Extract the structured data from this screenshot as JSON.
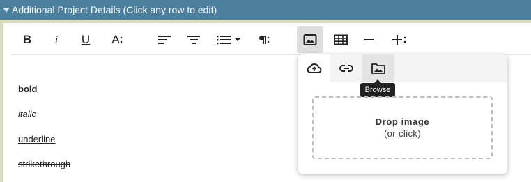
{
  "panel": {
    "title": "Additional Project Details (Click any row to edit)"
  },
  "toolbar": {
    "buttons": [
      {
        "name": "bold",
        "icon": "bold-icon"
      },
      {
        "name": "italic",
        "icon": "italic-icon"
      },
      {
        "name": "underline",
        "icon": "underline-icon"
      },
      {
        "name": "font-size",
        "icon": "font-size-icon"
      },
      {
        "name": "align-left",
        "icon": "align-left-icon"
      },
      {
        "name": "align-center",
        "icon": "align-center-icon"
      },
      {
        "name": "list",
        "icon": "unordered-list-icon"
      },
      {
        "name": "paragraph",
        "icon": "paragraph-icon"
      },
      {
        "name": "insert-image",
        "icon": "image-icon",
        "active": true
      },
      {
        "name": "insert-table",
        "icon": "table-icon"
      },
      {
        "name": "horizontal-rule",
        "icon": "minus-icon"
      },
      {
        "name": "insert-more",
        "icon": "plus-icon"
      },
      {
        "name": "more",
        "icon": "more-vertical-icon"
      }
    ],
    "glyphs": {
      "bold": "B",
      "italic": "i",
      "underline": "U",
      "font_size": "A"
    }
  },
  "content": {
    "lines": [
      "bold",
      "italic",
      "underline",
      "strikethrough"
    ]
  },
  "image_popup": {
    "tabs": [
      {
        "name": "upload",
        "icon": "cloud-upload-icon"
      },
      {
        "name": "by-url",
        "icon": "link-icon"
      },
      {
        "name": "browse",
        "icon": "image-folder-icon",
        "selected": true
      }
    ],
    "tooltip": "Browse",
    "dropzone_title": "Drop image",
    "dropzone_subtitle": "(or click)"
  },
  "colors": {
    "header_bg": "#4a7f9d",
    "frame_bg": "#d8dcc0",
    "active_button_bg": "#dedede"
  }
}
